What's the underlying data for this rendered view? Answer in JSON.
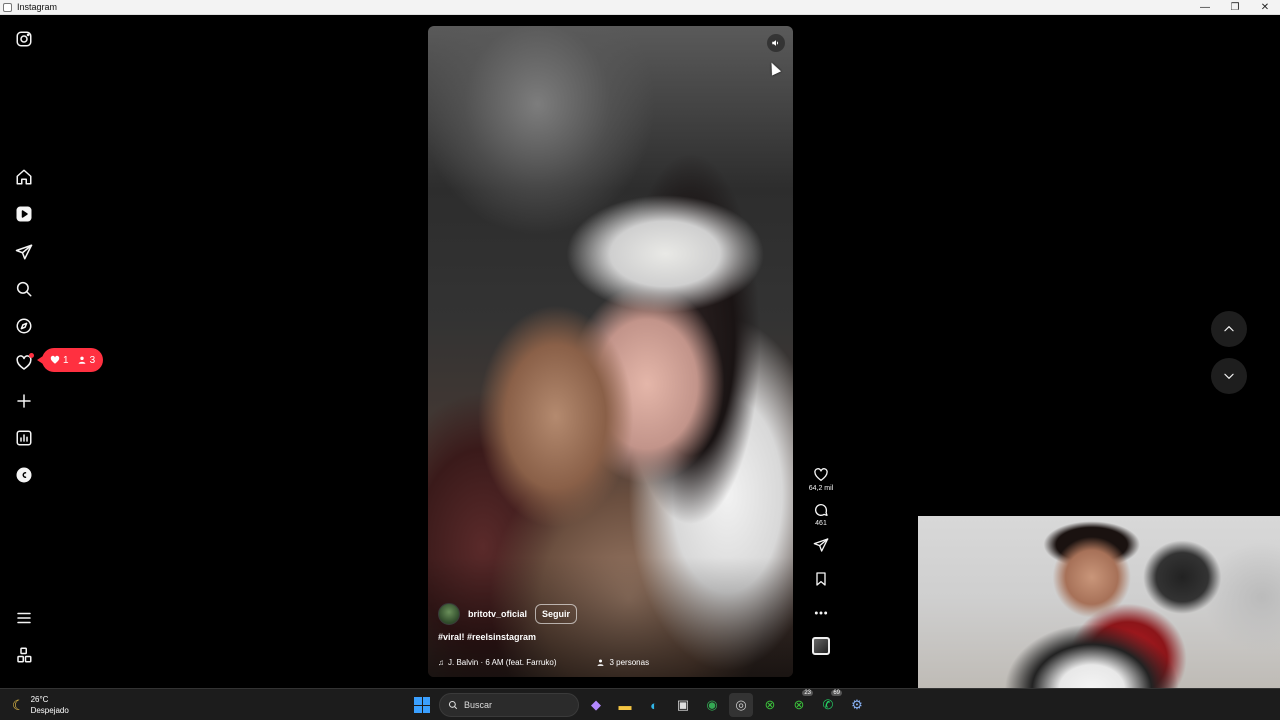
{
  "window": {
    "title": "Instagram",
    "controls": [
      "—",
      "❐",
      "✕"
    ]
  },
  "sidebar": {
    "items": [
      {
        "name": "instagram-logo-icon"
      },
      {
        "name": "home-icon"
      },
      {
        "name": "reels-icon"
      },
      {
        "name": "messages-icon"
      },
      {
        "name": "search-icon"
      },
      {
        "name": "explore-icon"
      },
      {
        "name": "notifications-icon"
      },
      {
        "name": "create-icon"
      },
      {
        "name": "dashboard-icon"
      },
      {
        "name": "threads-icon"
      },
      {
        "name": "menu-icon"
      },
      {
        "name": "also-from-meta-icon"
      }
    ],
    "notifications": {
      "likes": "1",
      "follows": "3"
    }
  },
  "reel": {
    "author": "britotv_oficial",
    "follow_label": "Seguir",
    "caption": "#viral! #reelsinstagram",
    "audio": "J. Balvin · 6 AM (feat. Farruko)",
    "tagged": "3 personas"
  },
  "actions": {
    "likes": "64,2 mil",
    "comments": "461"
  },
  "taskbar": {
    "weather_temp": "26°C",
    "weather_desc": "Despejado",
    "search_placeholder": "Buscar",
    "badges": {
      "xbox": "23",
      "whatsapp": "69"
    }
  }
}
